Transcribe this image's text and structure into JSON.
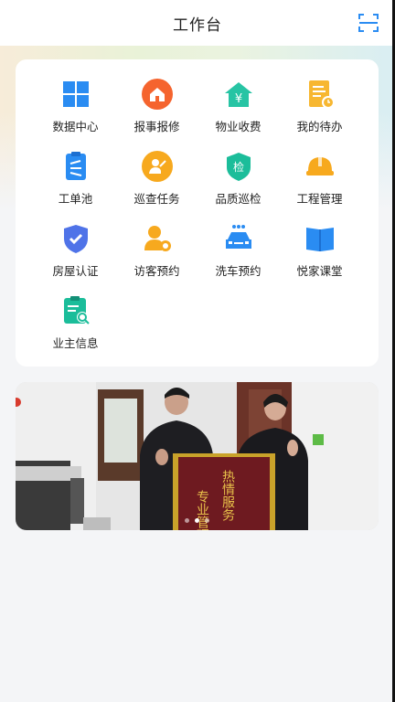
{
  "header": {
    "title": "工作台",
    "scan_icon": "scan-icon"
  },
  "grid_items": [
    {
      "label": "数据中心",
      "icon": "data-center-icon",
      "color": "#2a8cf2"
    },
    {
      "label": "报事报修",
      "icon": "repair-report-icon",
      "color": "#f5642e"
    },
    {
      "label": "物业收费",
      "icon": "property-fee-icon",
      "color": "#27c4a4"
    },
    {
      "label": "我的待办",
      "icon": "todo-icon",
      "color": "#f7b731"
    },
    {
      "label": "工单池",
      "icon": "work-order-icon",
      "color": "#2a8cf2"
    },
    {
      "label": "巡查任务",
      "icon": "patrol-task-icon",
      "color": "#f7a91e"
    },
    {
      "label": "品质巡检",
      "icon": "quality-inspect-icon",
      "color": "#1bbd9a"
    },
    {
      "label": "工程管理",
      "icon": "engineering-icon",
      "color": "#f7a91e"
    },
    {
      "label": "房屋认证",
      "icon": "house-auth-icon",
      "color": "#4f73e8"
    },
    {
      "label": "访客预约",
      "icon": "visitor-booking-icon",
      "color": "#f7a91e"
    },
    {
      "label": "洗车预约",
      "icon": "car-wash-icon",
      "color": "#2a8cf2"
    },
    {
      "label": "悦家课堂",
      "icon": "classroom-icon",
      "color": "#2a8cf2"
    },
    {
      "label": "业主信息",
      "icon": "owner-info-icon",
      "color": "#1bbd9a"
    }
  ],
  "banner": {
    "pennant_right": "热情服务",
    "pennant_left": "专业管理",
    "dots": [
      false,
      true,
      false
    ]
  }
}
